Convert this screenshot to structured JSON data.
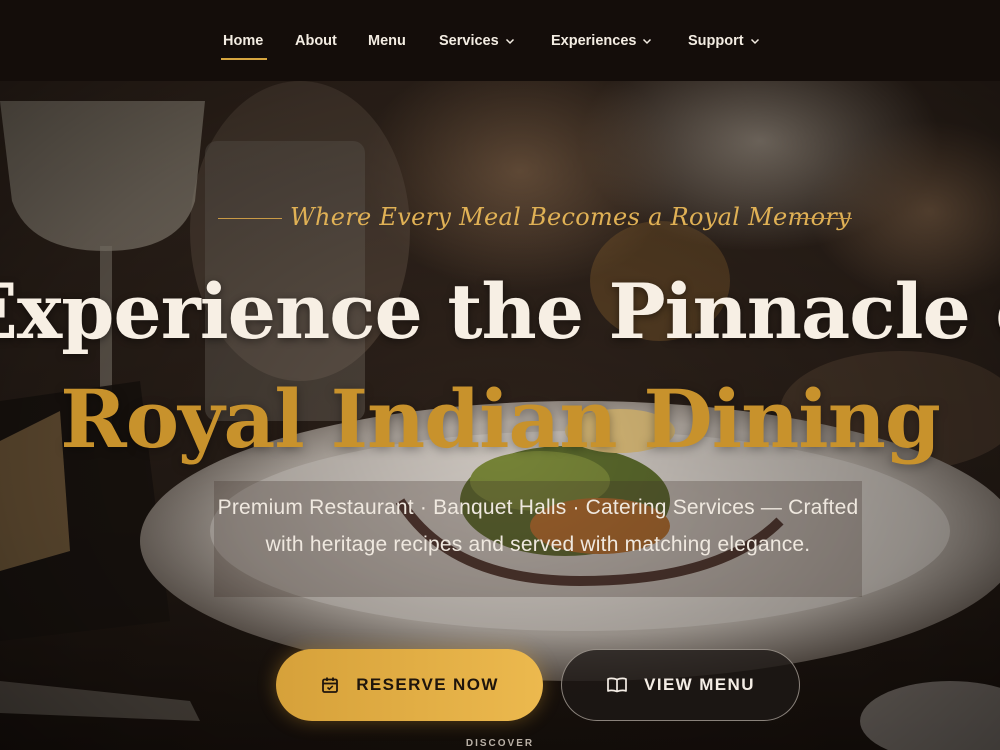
{
  "nav": {
    "items": [
      {
        "label": "Home",
        "active": true
      },
      {
        "label": "About",
        "active": false
      },
      {
        "label": "Menu",
        "active": false
      },
      {
        "label": "Services",
        "has_dropdown": true
      },
      {
        "label": "Experiences",
        "has_dropdown": true
      },
      {
        "label": "Support",
        "has_dropdown": true
      }
    ],
    "accent_color": "#d6a53f"
  },
  "hero": {
    "tagline": "Where Every Meal Becomes a Royal Memory",
    "headline_line1": "Experience the Pinnacle of",
    "headline_line2": "Royal Indian Dining",
    "subtitle": "Premium Restaurant · Banquet Halls · Catering Services — Crafted with heritage recipes and served with matching elegance.",
    "primary_cta": {
      "label": "RESERVE NOW",
      "icon": "calendar-icon"
    },
    "secondary_cta": {
      "label": "VIEW MENU",
      "icon": "book-icon"
    },
    "scroll_hint": "DISCOVER",
    "colors": {
      "gold": "#c8922c",
      "cream": "#f7efe4",
      "dark": "#140d0a"
    }
  }
}
